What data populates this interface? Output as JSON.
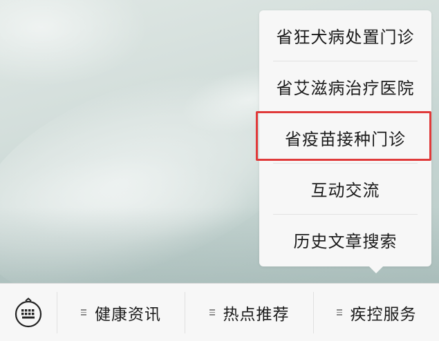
{
  "menu": {
    "items": [
      {
        "label": "省狂犬病处置门诊"
      },
      {
        "label": "省艾滋病治疗医院"
      },
      {
        "label": "省疫苗接种门诊"
      },
      {
        "label": "互动交流"
      },
      {
        "label": "历史文章搜索"
      }
    ],
    "highlighted_index": 2,
    "highlight_color": "#e03a3a"
  },
  "bottom_bar": {
    "keyboard_icon": "keyboard-icon",
    "tabs": [
      {
        "label": "健康资讯",
        "icon": "submenu-icon"
      },
      {
        "label": "热点推荐",
        "icon": "submenu-icon"
      },
      {
        "label": "疾控服务",
        "icon": "submenu-icon"
      }
    ]
  }
}
